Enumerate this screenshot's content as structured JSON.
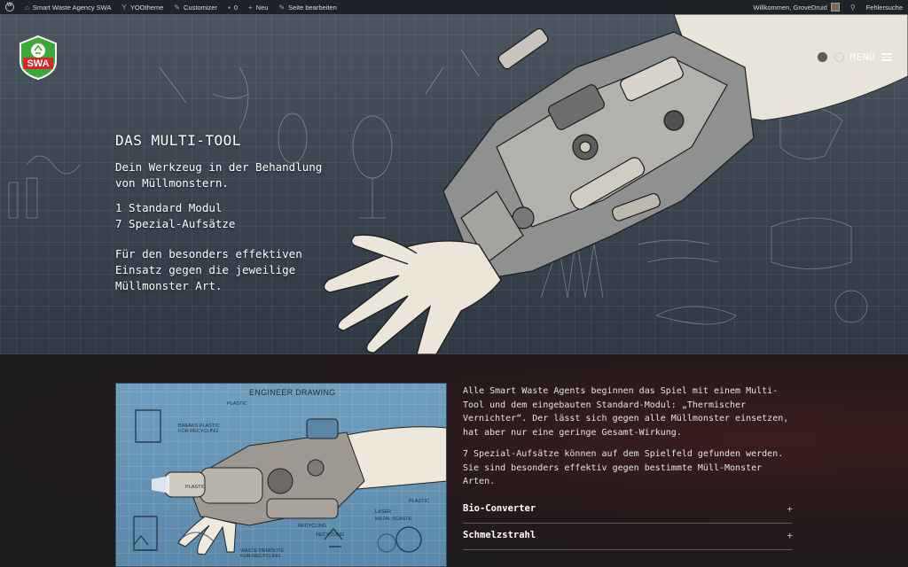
{
  "adminbar": {
    "site_name": "Smart Waste Agency SWA",
    "yootheme": "YOOtheme",
    "customizer": "Customizer",
    "comments_count": "0",
    "new": "Neu",
    "edit_page": "Seite bearbeiten",
    "welcome": "Willkommen, GroveDruid",
    "error_search": "Fehlersuche"
  },
  "logo": {
    "text": "SWA"
  },
  "nav": {
    "user": "GroveDruid",
    "menu": "MENÜ"
  },
  "hero": {
    "title": "DAS MULTI-TOOL",
    "subtitle": "Dein Werkzeug in der Behandlung von Müllmonstern.",
    "modules_line1": "1 Standard Modul",
    "modules_line2": "7 Spezial-Aufsätze",
    "description": "Für den besonders effektiven Einsatz gegen die jeweilige Müllmonster Art."
  },
  "drawing": {
    "title": "ENGINEER DRAWING",
    "labels": [
      "PLASTIC",
      "BREAKS PLASTIC FOR RECYCLING",
      "PLASTIC",
      "PLASTIC",
      "LASER",
      "METAL SCASTE",
      "RECYCLING",
      "WASTE DEMOLITE FOR RECYCLING",
      "RECYCLING"
    ]
  },
  "content": {
    "para1": "Alle Smart Waste Agents beginnen das Spiel mit einem Multi-Tool und dem eingebauten Standard-Modul: „Thermischer Vernichter“. Der lässt sich gegen alle Müllmonster einsetzen, hat aber nur eine geringe Gesamt-Wirkung.",
    "para2": "7 Spezial-Aufsätze können auf dem Spielfeld gefunden werden. Sie sind besonders effektiv gegen bestimmte Müll-Monster Arten.",
    "accordion": [
      {
        "label": "Bio-Converter",
        "icon": "plus-icon"
      },
      {
        "label": "Schmelzstrahl",
        "icon": "plus-icon"
      }
    ]
  },
  "colors": {
    "adminbar": "#1d2327",
    "logo_green": "#3aa935",
    "logo_red": "#d8252e"
  }
}
